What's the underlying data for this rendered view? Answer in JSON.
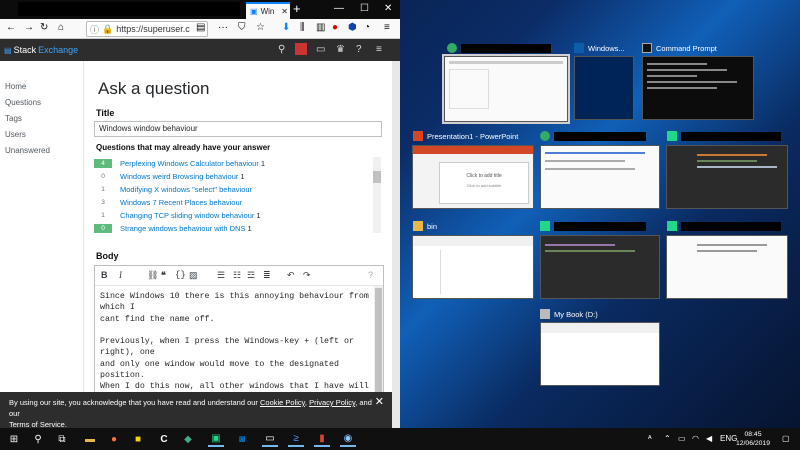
{
  "browser": {
    "tab_title": "Win",
    "url": "https://superuser.c",
    "site": {
      "logo_text": "Stack",
      "logo_text2": "Exchange"
    }
  },
  "leftnav": [
    "Home",
    "Questions",
    "Tags",
    "Users",
    "Unanswered"
  ],
  "ask": {
    "heading": "Ask a question",
    "title_label": "Title",
    "title_value": "Windows window behaviour",
    "similar_label": "Questions that may already have your answer",
    "similar": [
      {
        "score": "4",
        "title": "Perplexing Windows Calculator behaviour",
        "answers": "1",
        "positive": true
      },
      {
        "score": "0",
        "title": "Windows weird Browsing behaviour",
        "answers": "1",
        "positive": false
      },
      {
        "score": "1",
        "title": "Modifying X windows \"select\" behaviour",
        "answers": "",
        "positive": false
      },
      {
        "score": "3",
        "title": "Windows 7 Recent Places behaviour",
        "answers": "",
        "positive": false
      },
      {
        "score": "1",
        "title": "Changing TCP sliding window behaviour",
        "answers": "1",
        "positive": false
      },
      {
        "score": "0",
        "title": "Strange windows behaviour with DNS",
        "answers": "1",
        "positive": true
      }
    ],
    "body_label": "Body",
    "body_text": "Since Windows 10 there is this annoying behaviour from which I\ncant find the name off.\n\nPreviously, when I press the Windows-key + (left or right), one\nand only one window would move to the designated position.\nWhen I do this now, all other windows that I have will move to the\nopposite site and I need to select one of them in order to\ncontinue.\n\nI don't want to have this effect anymore, but I don't know how"
  },
  "cookie": {
    "text1": "By using our site, you acknowledge that you have read and understand our ",
    "link1": "Cookie Policy",
    "sep": ", ",
    "link2": "Privacy Policy",
    "text2": ", and our",
    "link3": "Terms of Service",
    "end": "."
  },
  "taskview": {
    "windows": [
      {
        "title": ""
      },
      {
        "title": "Windows..."
      },
      {
        "title": "Command Prompt"
      },
      {
        "title": "Presentation1 - PowerPoint",
        "thumb_text": "Click to add title",
        "thumb_sub": "Click to add subtitle"
      },
      {
        "title": ""
      },
      {
        "title": ""
      },
      {
        "title": "bin"
      },
      {
        "title": ""
      },
      {
        "title": ""
      },
      {
        "title": "My Book (D:)"
      }
    ]
  },
  "taskbar": {
    "lang": "ENG",
    "time": "08:45",
    "date": "12/06/2019"
  },
  "colors": {
    "accent": "#0a84ff",
    "so_link": "#0077cc",
    "score_green": "#5fba7d"
  }
}
